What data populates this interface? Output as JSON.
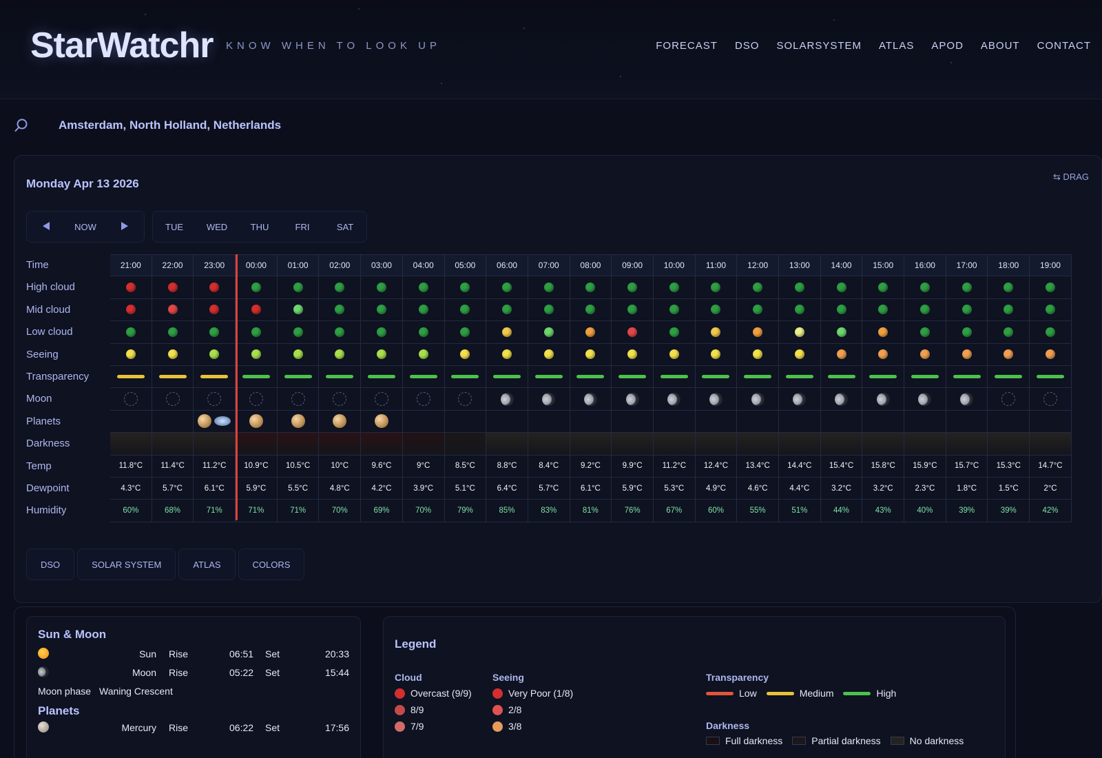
{
  "header": {
    "logo": "StarWatchr",
    "tagline": "KNOW WHEN TO LOOK UP",
    "nav": [
      "FORECAST",
      "DSO",
      "SOLARSYSTEM",
      "ATLAS",
      "APOD",
      "ABOUT",
      "CONTACT"
    ]
  },
  "search": {
    "location": "Amsterdam, North Holland, Netherlands"
  },
  "panel": {
    "date": "Monday Apr 13 2026",
    "drag_label": "⇆ DRAG",
    "nav_now": "NOW",
    "days": [
      "TUE",
      "WED",
      "THU",
      "FRI",
      "SAT"
    ],
    "row_labels": [
      "Time",
      "High cloud",
      "Mid cloud",
      "Low cloud",
      "Seeing",
      "Transparency",
      "Moon",
      "Planets",
      "Darkness",
      "Temp",
      "Dewpoint",
      "Humidity"
    ],
    "times": [
      "21:00",
      "22:00",
      "23:00",
      "00:00",
      "01:00",
      "02:00",
      "03:00",
      "04:00",
      "05:00",
      "06:00",
      "07:00",
      "08:00",
      "09:00",
      "10:00",
      "11:00",
      "12:00",
      "13:00",
      "14:00",
      "15:00",
      "16:00",
      "17:00",
      "18:00",
      "19:00"
    ],
    "temp": [
      "11.8°C",
      "11.4°C",
      "11.2°C",
      "10.9°C",
      "10.5°C",
      "10°C",
      "9.6°C",
      "9°C",
      "8.5°C",
      "8.8°C",
      "8.4°C",
      "9.2°C",
      "9.9°C",
      "11.2°C",
      "12.4°C",
      "13.4°C",
      "14.4°C",
      "15.4°C",
      "15.8°C",
      "15.9°C",
      "15.7°C",
      "15.3°C",
      "14.7°C"
    ],
    "dewpoint": [
      "4.3°C",
      "5.7°C",
      "6.1°C",
      "5.9°C",
      "5.5°C",
      "4.8°C",
      "4.2°C",
      "3.9°C",
      "5.1°C",
      "6.4°C",
      "5.7°C",
      "6.1°C",
      "5.9°C",
      "5.3°C",
      "4.9°C",
      "4.6°C",
      "4.4°C",
      "3.2°C",
      "3.2°C",
      "2.3°C",
      "1.8°C",
      "1.5°C",
      "2°C"
    ],
    "humidity": [
      "60%",
      "68%",
      "71%",
      "71%",
      "71%",
      "70%",
      "69%",
      "70%",
      "79%",
      "85%",
      "83%",
      "81%",
      "76%",
      "67%",
      "60%",
      "55%",
      "51%",
      "44%",
      "43%",
      "40%",
      "39%",
      "39%",
      "42%"
    ],
    "high_cloud": [
      "#d32f2f",
      "#d32f2f",
      "#d32f2f",
      "#2f9e44",
      "#2f9e44",
      "#2f9e44",
      "#2f9e44",
      "#2f9e44",
      "#2f9e44",
      "#2f9e44",
      "#2f9e44",
      "#2f9e44",
      "#2f9e44",
      "#2f9e44",
      "#2f9e44",
      "#2f9e44",
      "#2f9e44",
      "#2f9e44",
      "#2f9e44",
      "#2f9e44",
      "#2f9e44",
      "#2f9e44",
      "#2f9e44"
    ],
    "mid_cloud": [
      "#d32f2f",
      "#e04848",
      "#d32f2f",
      "#d32f2f",
      "#6fd66f",
      "#2f9e44",
      "#2f9e44",
      "#2f9e44",
      "#2f9e44",
      "#2f9e44",
      "#2f9e44",
      "#2f9e44",
      "#2f9e44",
      "#2f9e44",
      "#2f9e44",
      "#2f9e44",
      "#2f9e44",
      "#2f9e44",
      "#2f9e44",
      "#2f9e44",
      "#2f9e44",
      "#2f9e44",
      "#2f9e44"
    ],
    "low_cloud": [
      "#2f9e44",
      "#2f9e44",
      "#2f9e44",
      "#2f9e44",
      "#2f9e44",
      "#2f9e44",
      "#2f9e44",
      "#2f9e44",
      "#2f9e44",
      "#f2c94c",
      "#6fd66f",
      "#f0a040",
      "#e04848",
      "#2f9e44",
      "#f2c94c",
      "#f0a040",
      "#e9ef8a",
      "#6fd66f",
      "#f0a040",
      "#2f9e44",
      "#2f9e44",
      "#2f9e44",
      "#2f9e44"
    ],
    "seeing": [
      "#f2e14c",
      "#f2e14c",
      "#a8e04c",
      "#a8e04c",
      "#a8e04c",
      "#a8e04c",
      "#a8e04c",
      "#a8e04c",
      "#f2e14c",
      "#f2e14c",
      "#f2e14c",
      "#f2e14c",
      "#f2e14c",
      "#f2e14c",
      "#f2e14c",
      "#f2e14c",
      "#f2e14c",
      "#f0a050",
      "#f0a050",
      "#f0a050",
      "#f0a050",
      "#f0a050",
      "#f0a050"
    ],
    "transparency": [
      "#e9c23a",
      "#e9c23a",
      "#e9c23a",
      "#4cc24c",
      "#4cc24c",
      "#4cc24c",
      "#4cc24c",
      "#4cc24c",
      "#4cc24c",
      "#4cc24c",
      "#4cc24c",
      "#4cc24c",
      "#4cc24c",
      "#4cc24c",
      "#4cc24c",
      "#4cc24c",
      "#4cc24c",
      "#4cc24c",
      "#4cc24c",
      "#4cc24c",
      "#4cc24c",
      "#4cc24c",
      "#4cc24c"
    ],
    "moon": [
      "none",
      "none",
      "none",
      "none",
      "none",
      "none",
      "none",
      "none",
      "none",
      "crescent",
      "crescent",
      "crescent",
      "crescent",
      "crescent",
      "crescent",
      "crescent",
      "crescent",
      "crescent",
      "crescent",
      "crescent",
      "crescent",
      "none",
      "none"
    ],
    "planets": [
      [],
      [],
      [
        "jupiter-icon",
        "saturn-icon"
      ],
      [
        "jupiter-icon"
      ],
      [
        "jupiter-icon"
      ],
      [
        "jupiter-icon"
      ],
      [
        "jupiter-icon"
      ],
      [],
      [],
      [],
      [],
      [],
      [],
      [],
      [],
      [],
      [],
      [],
      [],
      [],
      [],
      [],
      []
    ],
    "darkness": [
      "#26221f",
      "#26221f",
      "#26221f",
      "#2a1214",
      "#2a1214",
      "#2a1214",
      "#2a1214",
      "#221214",
      "#1c1718",
      "#252320",
      "#252320",
      "#252320",
      "#252320",
      "#252320",
      "#252320",
      "#252320",
      "#252320",
      "#252320",
      "#252320",
      "#252320",
      "#252320",
      "#252320",
      "#252320"
    ],
    "tabs": [
      "DSO",
      "SOLAR SYSTEM",
      "ATLAS",
      "COLORS"
    ]
  },
  "sun_moon": {
    "title": "Sun & Moon",
    "rows": [
      {
        "name": "Sun",
        "rise_label": "Rise",
        "rise": "06:51",
        "set_label": "Set",
        "set": "20:33"
      },
      {
        "name": "Moon",
        "rise_label": "Rise",
        "rise": "05:22",
        "set_label": "Set",
        "set": "15:44"
      }
    ],
    "phase_label": "Moon phase",
    "phase_value": "Waning Crescent",
    "planets_title": "Planets",
    "planet_rows": [
      {
        "name": "Mercury",
        "rise_label": "Rise",
        "rise": "06:22",
        "set_label": "Set",
        "set": "17:56"
      }
    ]
  },
  "legend": {
    "title": "Legend",
    "cloud_title": "Cloud",
    "cloud_items": [
      {
        "label": "Overcast (9/9)",
        "color": "#d32f2f"
      },
      {
        "label": "8/9",
        "color": "#c44a4a"
      },
      {
        "label": "7/9",
        "color": "#d36a6a"
      }
    ],
    "seeing_title": "Seeing",
    "seeing_items": [
      {
        "label": "Very Poor (1/8)",
        "color": "#d32f2f"
      },
      {
        "label": "2/8",
        "color": "#e05252"
      },
      {
        "label": "3/8",
        "color": "#e89a5a"
      }
    ],
    "transparency_title": "Transparency",
    "transparency_items": [
      {
        "label": "Low",
        "color": "#e2553a"
      },
      {
        "label": "Medium",
        "color": "#e9c23a"
      },
      {
        "label": "High",
        "color": "#4cc24c"
      }
    ],
    "darkness_title": "Darkness",
    "darkness_items": [
      {
        "label": "Full darkness",
        "color": "#1a0f12"
      },
      {
        "label": "Partial darkness",
        "color": "#1c1718"
      },
      {
        "label": "No darkness",
        "color": "#252320"
      }
    ]
  }
}
